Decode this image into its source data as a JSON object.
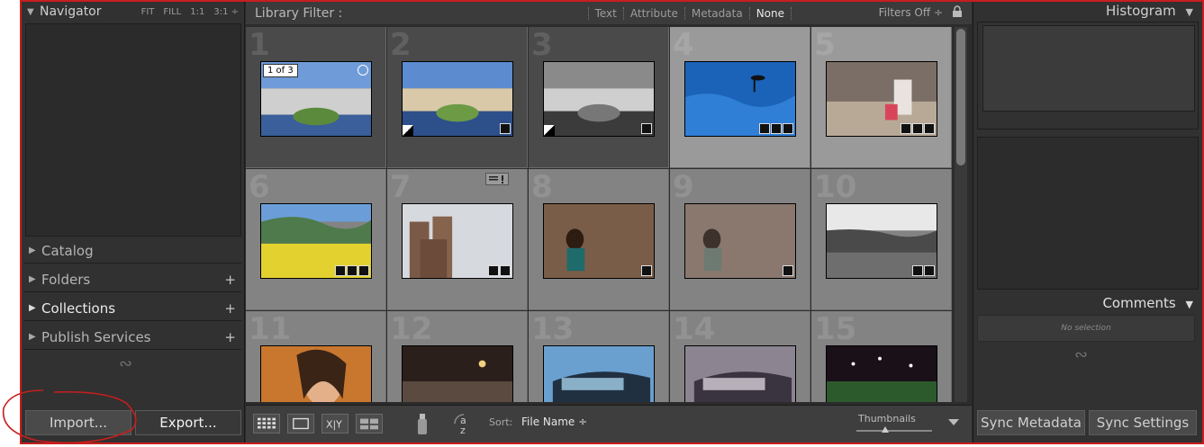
{
  "left": {
    "navigator": {
      "title": "Navigator",
      "options": [
        "FIT",
        "FILL",
        "1:1",
        "3:1 ÷"
      ]
    },
    "sections": [
      {
        "label": "Catalog",
        "has_plus": false,
        "bright": false
      },
      {
        "label": "Folders",
        "has_plus": true,
        "bright": false
      },
      {
        "label": "Collections",
        "has_plus": true,
        "bright": true
      },
      {
        "label": "Publish Services",
        "has_plus": true,
        "bright": false
      }
    ],
    "import_label": "Import...",
    "export_label": "Export..."
  },
  "filter": {
    "title": "Library Filter :",
    "tabs": [
      "Text",
      "Attribute",
      "Metadata",
      "None"
    ],
    "active_tab": "None",
    "filters_off": "Filters Off ÷"
  },
  "grid": {
    "cells": [
      {
        "num": "1",
        "count_badge": "1 of 3",
        "style": "dark"
      },
      {
        "num": "2",
        "style": "dark"
      },
      {
        "num": "3",
        "style": "dark"
      },
      {
        "num": "4",
        "style": "sel"
      },
      {
        "num": "5",
        "style": "sel"
      },
      {
        "num": "6",
        "style": "normal"
      },
      {
        "num": "7",
        "style": "normal"
      },
      {
        "num": "8",
        "style": "normal"
      },
      {
        "num": "9",
        "style": "normal"
      },
      {
        "num": "10",
        "style": "normal"
      },
      {
        "num": "11",
        "style": "normal"
      },
      {
        "num": "12",
        "style": "normal"
      },
      {
        "num": "13",
        "style": "normal"
      },
      {
        "num": "14",
        "style": "normal"
      },
      {
        "num": "15",
        "style": "normal"
      }
    ]
  },
  "toolbar": {
    "sort_label": "Sort:",
    "sort_value": "File Name ÷",
    "thumbnails_label": "Thumbnails"
  },
  "right": {
    "histogram_title": "Histogram",
    "comments_title": "Comments",
    "no_selection": "No selection",
    "sync_metadata": "Sync Metadata",
    "sync_settings": "Sync Settings"
  },
  "colors": {
    "annotation": "#c81e1e",
    "panel": "#313131",
    "grid_cell": "#838383"
  }
}
